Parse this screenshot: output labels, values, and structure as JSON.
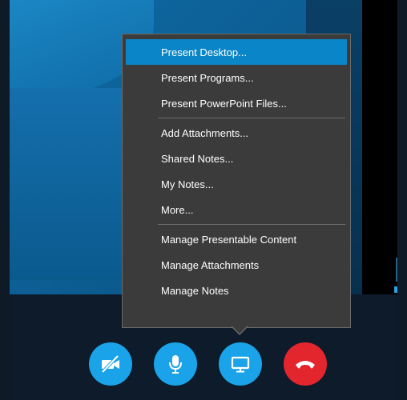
{
  "menu": {
    "items": [
      {
        "label": "Present Desktop...",
        "active": true
      },
      {
        "label": "Present Programs..."
      },
      {
        "label": "Present PowerPoint Files..."
      },
      {
        "label": "Add Attachments..."
      },
      {
        "label": "Shared Notes..."
      },
      {
        "label": "My Notes..."
      },
      {
        "label": "More..."
      },
      {
        "label": "Manage Presentable Content"
      },
      {
        "label": "Manage Attachments"
      },
      {
        "label": "Manage Notes"
      }
    ]
  },
  "controls": [
    {
      "name": "video-off-button",
      "icon": "video-off-icon",
      "color": "#1aa3e8"
    },
    {
      "name": "microphone-button",
      "icon": "microphone-icon",
      "color": "#1aa3e8"
    },
    {
      "name": "present-button",
      "icon": "monitor-icon",
      "color": "#1aa3e8"
    },
    {
      "name": "hang-up-button",
      "icon": "phone-hangup-icon",
      "color": "#e3252e"
    }
  ],
  "colors": {
    "menu_background": "#3b3b3b",
    "menu_highlight": "#0a86c8",
    "accent_blue": "#1aa3e8",
    "hangup_red": "#e3252e"
  }
}
